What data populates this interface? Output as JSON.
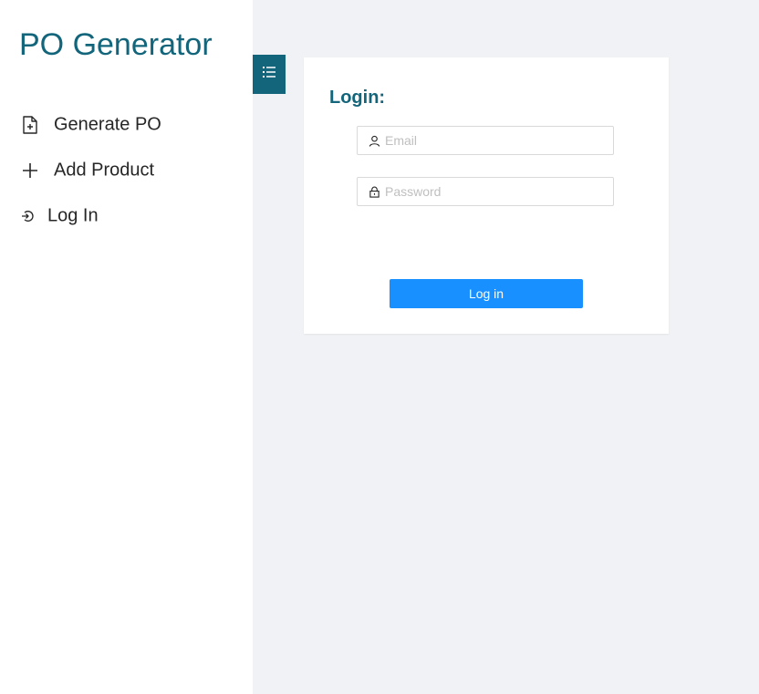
{
  "app": {
    "title": "PO Generator",
    "accent_color": "#12657a"
  },
  "sidebar": {
    "items": [
      {
        "label": "Generate PO",
        "icon": "file-add-icon"
      },
      {
        "label": "Add Product",
        "icon": "plus-icon"
      },
      {
        "label": "Log In",
        "icon": "login-icon"
      }
    ]
  },
  "toggle": {
    "icon": "menu-unfold-icon"
  },
  "login": {
    "title": "Login:",
    "email": {
      "placeholder": "Email",
      "value": "",
      "icon": "user-icon"
    },
    "password": {
      "placeholder": "Password",
      "value": "",
      "icon": "lock-icon"
    },
    "submit_label": "Log in",
    "submit_color": "#1890ff"
  }
}
